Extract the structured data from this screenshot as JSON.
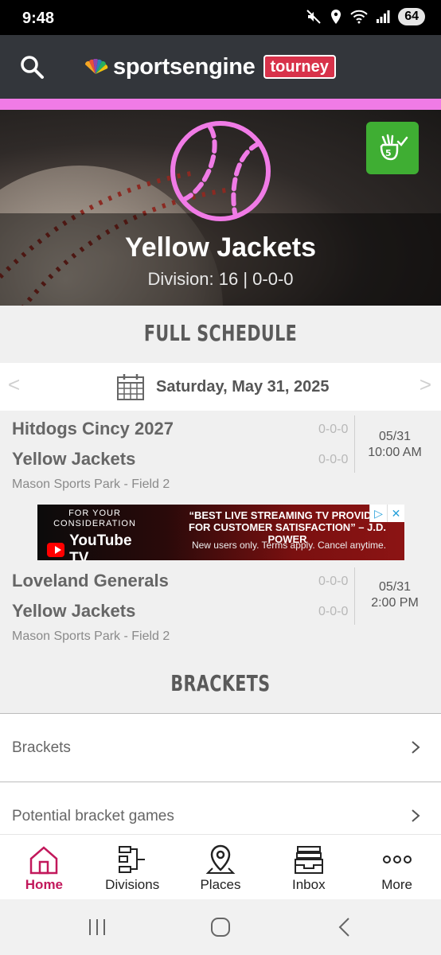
{
  "status_bar": {
    "time": "9:48",
    "battery": "64"
  },
  "header": {
    "logo_text": "sportsengine",
    "logo_badge": "tourney"
  },
  "hero": {
    "team_name": "Yellow Jackets",
    "division_line": "Division: 16 | 0-0-0"
  },
  "schedule": {
    "title": "FULL SCHEDULE",
    "date": "Saturday, May 31, 2025",
    "prev_arrow": "<",
    "next_arrow": ">",
    "games": [
      {
        "team1": "Hitdogs Cincy 2027",
        "team1_record": "0-0-0",
        "team2": "Yellow Jackets",
        "team2_record": "0-0-0",
        "venue": "Mason Sports Park - Field 2",
        "date": "05/31",
        "time": "10:00 AM"
      },
      {
        "team1": "Loveland Generals",
        "team1_record": "0-0-0",
        "team2": "Yellow Jackets",
        "team2_record": "0-0-0",
        "venue": "Mason Sports Park - Field 2",
        "date": "05/31",
        "time": "2:00 PM"
      }
    ]
  },
  "ad": {
    "line1": "FOR YOUR",
    "line2": "CONSIDERATION",
    "brand": "YouTube TV",
    "quote1": "“BEST LIVE STREAMING TV PROVIDER",
    "quote2": "FOR CUSTOMER SATISFACTION” – J.D. POWER",
    "fine": "New users only. Terms apply. Cancel anytime.",
    "badge_info": "▷",
    "badge_close": "✕"
  },
  "brackets": {
    "title": "BRACKETS",
    "items": [
      {
        "label": "Brackets"
      },
      {
        "label": "Potential bracket games"
      }
    ]
  },
  "bottom_nav": {
    "items": [
      {
        "label": "Home",
        "icon": "home-icon"
      },
      {
        "label": "Divisions",
        "icon": "divisions-icon"
      },
      {
        "label": "Places",
        "icon": "map-pin-icon"
      },
      {
        "label": "Inbox",
        "icon": "inbox-icon"
      },
      {
        "label": "More",
        "icon": "more-icon"
      }
    ]
  },
  "colors": {
    "accent": "#c2185b",
    "stripe": "#f07be6",
    "checkin": "#3fae33",
    "header": "#33363b",
    "badge": "#d8324a"
  }
}
